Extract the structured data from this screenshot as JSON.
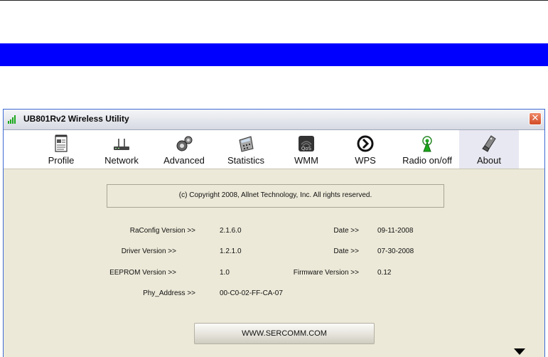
{
  "window": {
    "title": "UB801Rv2  Wireless Utility",
    "close_glyph": "✕"
  },
  "toolbar": {
    "items": [
      {
        "label": "Profile",
        "icon": "profile-icon"
      },
      {
        "label": "Network",
        "icon": "router-icon"
      },
      {
        "label": "Advanced",
        "icon": "gears-icon"
      },
      {
        "label": "Statistics",
        "icon": "calculator-icon"
      },
      {
        "label": "WMM",
        "icon": "qos-icon"
      },
      {
        "label": "WPS",
        "icon": "wps-icon"
      },
      {
        "label": "Radio on/off",
        "icon": "antenna-icon"
      },
      {
        "label": "About",
        "icon": "usb-stick-icon"
      }
    ],
    "active": "About"
  },
  "about": {
    "copyright": "(c) Copyright 2008, Allnet Technology, Inc.  All rights reserved.",
    "raconfig_label": "RaConfig Version >>",
    "raconfig_value": "2.1.6.0",
    "raconfig_date_label": "Date >>",
    "raconfig_date_value": "09-11-2008",
    "driver_label": "Driver Version >>",
    "driver_value": "1.2.1.0",
    "driver_date_label": "Date >>",
    "driver_date_value": "07-30-2008",
    "eeprom_label": "EEPROM Version >>",
    "eeprom_value": "1.0",
    "firmware_label": "Firmware Version >>",
    "firmware_value": "0.12",
    "phy_label": "Phy_Address >>",
    "phy_value": "00-C0-02-FF-CA-07",
    "website_button": "WWW.SERCOMM.COM"
  },
  "colors": {
    "band": "#0000ff",
    "window_bg": "#ece9d8",
    "signal": "#1ba81b",
    "close": "#d24a26"
  }
}
